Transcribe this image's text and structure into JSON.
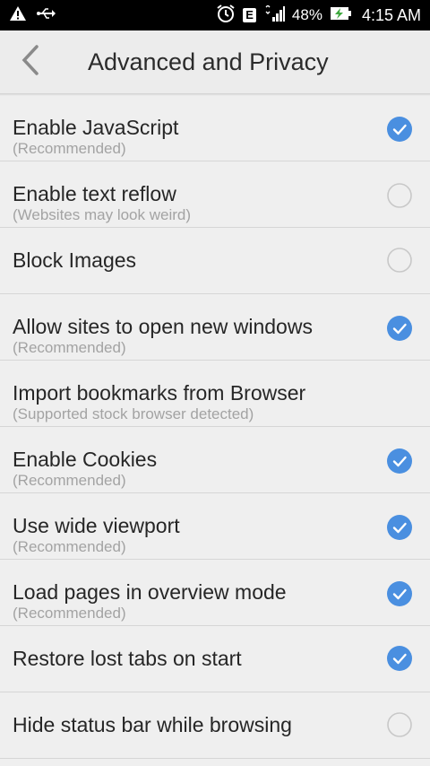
{
  "status_bar": {
    "battery": "48%",
    "time": "4:15 AM",
    "network": "E"
  },
  "app_bar": {
    "title": "Advanced and Privacy"
  },
  "colors": {
    "accent": "#4a8fe0",
    "unchecked_border": "#c8c8c8"
  },
  "settings": [
    {
      "title": "Enable JavaScript",
      "subtitle": "(Recommended)",
      "checked": true
    },
    {
      "title": "Enable text reflow",
      "subtitle": "(Websites may look weird)",
      "checked": false
    },
    {
      "title": "Block Images",
      "subtitle": "",
      "checked": false
    },
    {
      "title": "Allow sites to open new windows",
      "subtitle": "(Recommended)",
      "checked": true
    },
    {
      "title": "Import bookmarks from Browser",
      "subtitle": "(Supported stock browser detected)",
      "checked": null
    },
    {
      "title": "Enable Cookies",
      "subtitle": "(Recommended)",
      "checked": true
    },
    {
      "title": "Use wide viewport",
      "subtitle": "(Recommended)",
      "checked": true
    },
    {
      "title": "Load pages in overview mode",
      "subtitle": "(Recommended)",
      "checked": true
    },
    {
      "title": "Restore lost tabs on start",
      "subtitle": "",
      "checked": true
    },
    {
      "title": "Hide status bar while browsing",
      "subtitle": "",
      "checked": false
    }
  ]
}
